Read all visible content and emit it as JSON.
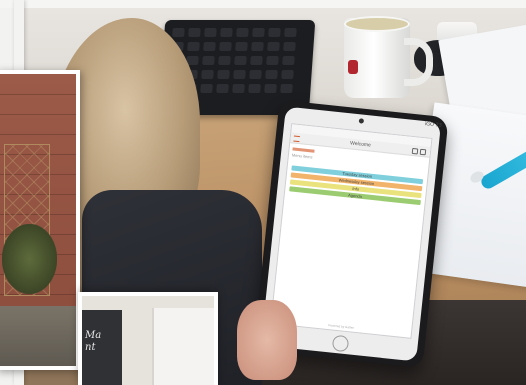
{
  "tablet": {
    "model_label": "iGO 73",
    "app": {
      "nav_title": "Welcome",
      "subtitle": "Menu items",
      "menu_bars": [
        {
          "label": "Tuesday session",
          "color": "#7fd0dc"
        },
        {
          "label": "Wednesday session",
          "color": "#f2b46b"
        },
        {
          "label": "Info",
          "color": "#e9e27d"
        },
        {
          "label": "Agenda",
          "color": "#9ccc71"
        }
      ],
      "footer": "Powered by Gather"
    }
  },
  "chalkboard": {
    "line1": "Ma",
    "line2": "nt"
  }
}
